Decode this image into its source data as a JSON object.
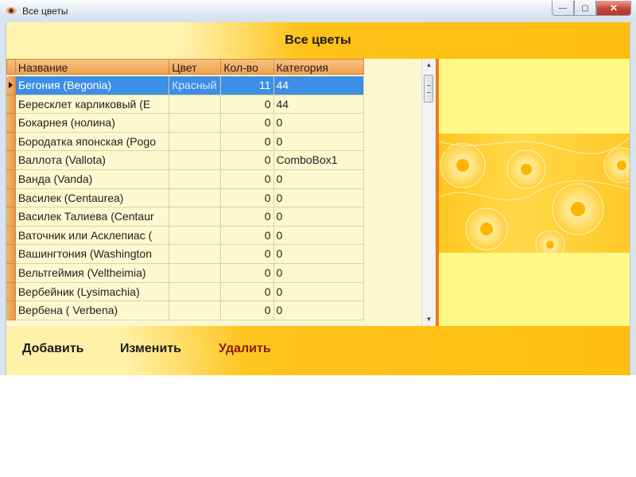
{
  "window": {
    "title": "Все цветы",
    "controls": {
      "minimize": "—",
      "maximize": "▢",
      "close": "✕"
    }
  },
  "header": {
    "title": "Все цветы"
  },
  "grid": {
    "columns": [
      "Название",
      "Цвет",
      "Кол-во",
      "Категория"
    ],
    "rows": [
      {
        "name": "Бегония (Begonia)",
        "color": "Красный",
        "qty": "11",
        "category": "44",
        "selected": true
      },
      {
        "name": "Бересклет карликовый (E",
        "color": "",
        "qty": "0",
        "category": "44"
      },
      {
        "name": "Бокарнея (нолина)",
        "color": "",
        "qty": "0",
        "category": "0"
      },
      {
        "name": "Бородатка японская (Pogo",
        "color": "",
        "qty": "0",
        "category": "0"
      },
      {
        "name": "Валлота (Vallota)",
        "color": "",
        "qty": "0",
        "category": "ComboBox1"
      },
      {
        "name": "Ванда (Vanda)",
        "color": "",
        "qty": "0",
        "category": "0"
      },
      {
        "name": "Василек (Centaurea)",
        "color": "",
        "qty": "0",
        "category": "0"
      },
      {
        "name": "Василек Талиева (Centaur",
        "color": "",
        "qty": "0",
        "category": "0"
      },
      {
        "name": "Ваточник или Асклепиас (",
        "color": "",
        "qty": "0",
        "category": "0"
      },
      {
        "name": "Вашингтония (Washington",
        "color": "",
        "qty": "0",
        "category": "0"
      },
      {
        "name": "Вельтгеймия (Veltheimia)",
        "color": "",
        "qty": "0",
        "category": "0"
      },
      {
        "name": "Вербейник (Lysimachia)",
        "color": "",
        "qty": "0",
        "category": "0"
      },
      {
        "name": "Вербена ( Verbena)",
        "color": "",
        "qty": "0",
        "category": "0"
      }
    ]
  },
  "scrollbar": {
    "up": "▲",
    "down": "▼"
  },
  "footer": {
    "add_label": "Добавить",
    "edit_label": "Изменить",
    "delete_label": "Удалить"
  },
  "colors": {
    "header_bg": "#ffc21a",
    "selection": "#3d8ee6",
    "grid_bg": "#fdf8cf",
    "column_header": "#f0a050",
    "divider": "#f07a1a",
    "delete_text": "#8b1a0a"
  },
  "icons": [
    "app-icon",
    "minimize-icon",
    "maximize-icon",
    "close-icon",
    "row-pointer-icon",
    "scroll-up-icon",
    "scroll-down-icon"
  ]
}
